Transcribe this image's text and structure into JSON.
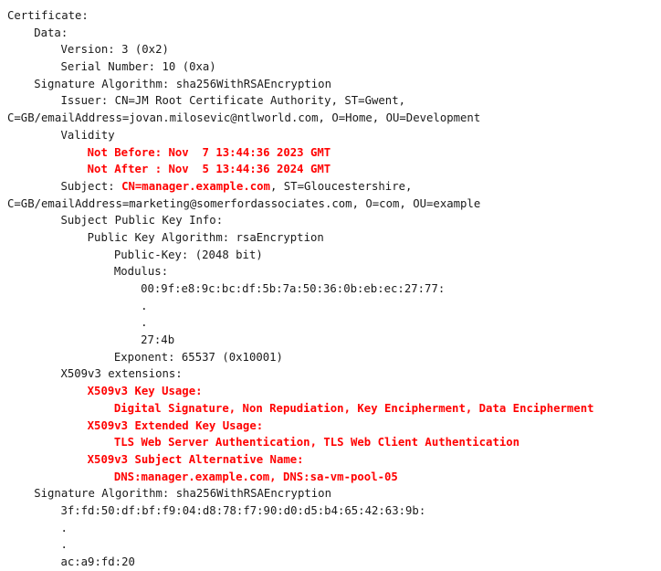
{
  "document": {
    "kind": "x509-certificate-text-dump",
    "background_color": "#ffffff",
    "text_color": "#1a1a1a",
    "highlight_color": "#ff0000"
  },
  "lines": [
    {
      "id": "line-certificate",
      "indent": 0,
      "segments": [
        {
          "text": "Certificate:",
          "style": "plain"
        }
      ]
    },
    {
      "id": "line-data",
      "indent": 4,
      "segments": [
        {
          "text": "Data:",
          "style": "plain"
        }
      ]
    },
    {
      "id": "line-version",
      "indent": 8,
      "segments": [
        {
          "text": "Version: 3 (0x2)",
          "style": "plain"
        }
      ]
    },
    {
      "id": "line-serial-number",
      "indent": 8,
      "segments": [
        {
          "text": "Serial Number: 10 (0xa)",
          "style": "plain"
        }
      ]
    },
    {
      "id": "line-signature-algorithm-top",
      "indent": 4,
      "segments": [
        {
          "text": "Signature Algorithm: sha256WithRSAEncryption",
          "style": "plain"
        }
      ]
    },
    {
      "id": "line-issuer",
      "indent": 8,
      "segments": [
        {
          "text": "Issuer: CN=JM Root Certificate Authority, ST=Gwent,",
          "style": "plain"
        }
      ]
    },
    {
      "id": "line-issuer-wrap",
      "indent": 0,
      "segments": [
        {
          "text": "C=GB/emailAddress=jovan.milosevic@ntlworld.com, O=Home, OU=Development",
          "style": "plain"
        }
      ]
    },
    {
      "id": "line-validity",
      "indent": 8,
      "segments": [
        {
          "text": "Validity",
          "style": "plain"
        }
      ]
    },
    {
      "id": "line-not-before",
      "indent": 12,
      "segments": [
        {
          "text": "Not Before: Nov  7 13:44:36 2023 GMT",
          "style": "red"
        }
      ]
    },
    {
      "id": "line-not-after",
      "indent": 12,
      "segments": [
        {
          "text": "Not After : Nov  5 13:44:36 2024 GMT",
          "style": "red"
        }
      ]
    },
    {
      "id": "line-subject",
      "indent": 8,
      "segments": [
        {
          "text": "Subject: ",
          "style": "plain"
        },
        {
          "text": "CN=manager.example.com",
          "style": "red"
        },
        {
          "text": ", ST=Gloucestershire,",
          "style": "plain"
        }
      ]
    },
    {
      "id": "line-subject-wrap",
      "indent": 0,
      "segments": [
        {
          "text": "C=GB/emailAddress=marketing@somerfordassociates.com, O=com, OU=example",
          "style": "plain"
        }
      ]
    },
    {
      "id": "line-subject-public-key-info",
      "indent": 8,
      "segments": [
        {
          "text": "Subject Public Key Info:",
          "style": "plain"
        }
      ]
    },
    {
      "id": "line-public-key-algorithm",
      "indent": 12,
      "segments": [
        {
          "text": "Public Key Algorithm: rsaEncryption",
          "style": "plain"
        }
      ]
    },
    {
      "id": "line-public-key-bits",
      "indent": 16,
      "segments": [
        {
          "text": "Public-Key: (2048 bit)",
          "style": "plain"
        }
      ]
    },
    {
      "id": "line-modulus-label",
      "indent": 16,
      "segments": [
        {
          "text": "Modulus:",
          "style": "plain"
        }
      ]
    },
    {
      "id": "line-modulus-hex-first",
      "indent": 20,
      "segments": [
        {
          "text": "00:9f:e8:9c:bc:df:5b:7a:50:36:0b:eb:ec:27:77:",
          "style": "plain"
        }
      ]
    },
    {
      "id": "line-modulus-ellipsis-1",
      "indent": 20,
      "segments": [
        {
          "text": ".",
          "style": "plain"
        }
      ]
    },
    {
      "id": "line-modulus-ellipsis-2",
      "indent": 20,
      "segments": [
        {
          "text": ".",
          "style": "plain"
        }
      ]
    },
    {
      "id": "line-modulus-hex-last",
      "indent": 20,
      "segments": [
        {
          "text": "27:4b",
          "style": "plain"
        }
      ]
    },
    {
      "id": "line-exponent",
      "indent": 16,
      "segments": [
        {
          "text": "Exponent: 65537 (0x10001)",
          "style": "plain"
        }
      ]
    },
    {
      "id": "line-x509v3-extensions",
      "indent": 8,
      "segments": [
        {
          "text": "X509v3 extensions:",
          "style": "plain"
        }
      ]
    },
    {
      "id": "line-key-usage-header",
      "indent": 12,
      "segments": [
        {
          "text": "X509v3 Key Usage:",
          "style": "red"
        }
      ]
    },
    {
      "id": "line-key-usage-value",
      "indent": 16,
      "segments": [
        {
          "text": "Digital Signature, Non Repudiation, Key Encipherment, Data Encipherment",
          "style": "red"
        }
      ]
    },
    {
      "id": "line-extended-key-usage-header",
      "indent": 12,
      "segments": [
        {
          "text": "X509v3 Extended Key Usage:",
          "style": "red"
        }
      ]
    },
    {
      "id": "line-extended-key-usage-value",
      "indent": 16,
      "segments": [
        {
          "text": "TLS Web Server Authentication, TLS Web Client Authentication",
          "style": "red"
        }
      ]
    },
    {
      "id": "line-san-header",
      "indent": 12,
      "segments": [
        {
          "text": "X509v3 Subject Alternative Name:",
          "style": "red"
        }
      ]
    },
    {
      "id": "line-san-value",
      "indent": 16,
      "segments": [
        {
          "text": "DNS:manager.example.com, DNS:sa-vm-pool-05",
          "style": "red"
        }
      ]
    },
    {
      "id": "line-signature-algorithm-bottom",
      "indent": 4,
      "segments": [
        {
          "text": "Signature Algorithm: sha256WithRSAEncryption",
          "style": "plain"
        }
      ]
    },
    {
      "id": "line-signature-hex-first",
      "indent": 8,
      "segments": [
        {
          "text": "3f:fd:50:df:bf:f9:04:d8:78:f7:90:d0:d5:b4:65:42:63:9b:",
          "style": "plain"
        }
      ]
    },
    {
      "id": "line-signature-ellipsis-1",
      "indent": 8,
      "segments": [
        {
          "text": ".",
          "style": "plain"
        }
      ]
    },
    {
      "id": "line-signature-ellipsis-2",
      "indent": 8,
      "segments": [
        {
          "text": ".",
          "style": "plain"
        }
      ]
    },
    {
      "id": "line-signature-hex-last",
      "indent": 8,
      "segments": [
        {
          "text": "ac:a9:fd:20",
          "style": "plain"
        }
      ]
    }
  ]
}
